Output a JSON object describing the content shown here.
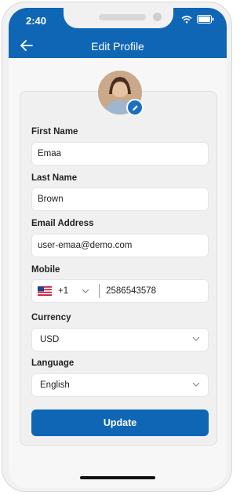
{
  "status": {
    "time": "2:40"
  },
  "header": {
    "title": "Edit Profile"
  },
  "form": {
    "first_name": {
      "label": "First Name",
      "value": "Emaa"
    },
    "last_name": {
      "label": "Last Name",
      "value": "Brown"
    },
    "email": {
      "label": "Email Address",
      "value": "user-emaa@demo.com"
    },
    "mobile": {
      "label": "Mobile",
      "country_code": "+1",
      "number": "2586543578"
    },
    "currency": {
      "label": "Currency",
      "value": "USD"
    },
    "language": {
      "label": "Language",
      "value": "English"
    },
    "submit_label": "Update"
  },
  "colors": {
    "primary": "#0f66b5",
    "card": "#f0f0f0"
  }
}
